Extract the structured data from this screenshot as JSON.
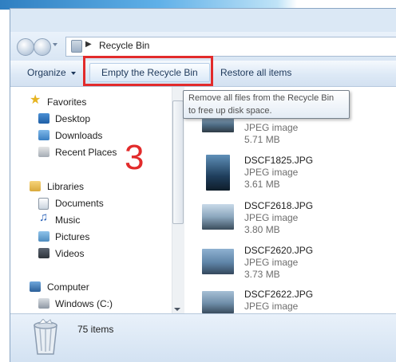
{
  "address": {
    "breadcrumb_label": "Recycle Bin"
  },
  "toolbar": {
    "organize_label": "Organize",
    "empty_bin_label": "Empty the Recycle Bin",
    "restore_label": "Restore all items"
  },
  "tooltip": {
    "line1": "Remove all files from the Recycle Bin",
    "line2": "to free up disk space."
  },
  "annotation": {
    "step_number": "3"
  },
  "nav": {
    "favorites": {
      "label": "Favorites",
      "icon": "star-icon",
      "items": [
        {
          "label": "Desktop",
          "icon": "desktop-icon"
        },
        {
          "label": "Downloads",
          "icon": "downloads-icon"
        },
        {
          "label": "Recent Places",
          "icon": "recent-places-icon"
        }
      ]
    },
    "libraries": {
      "label": "Libraries",
      "icon": "libraries-icon",
      "items": [
        {
          "label": "Documents",
          "icon": "documents-icon"
        },
        {
          "label": "Music",
          "icon": "music-icon"
        },
        {
          "label": "Pictures",
          "icon": "pictures-icon"
        },
        {
          "label": "Videos",
          "icon": "videos-icon"
        }
      ]
    },
    "computer": {
      "label": "Computer",
      "icon": "computer-icon",
      "items": [
        {
          "label": "Windows (C:)",
          "icon": "drive-icon"
        }
      ]
    }
  },
  "files": [
    {
      "name": "",
      "type": "JPEG image",
      "size": "5.71 MB"
    },
    {
      "name": "DSCF1825.JPG",
      "type": "JPEG image",
      "size": "3.61 MB"
    },
    {
      "name": "DSCF2618.JPG",
      "type": "JPEG image",
      "size": "3.80 MB"
    },
    {
      "name": "DSCF2620.JPG",
      "type": "JPEG image",
      "size": "3.73 MB"
    },
    {
      "name": "DSCF2622.JPG",
      "type": "JPEG image",
      "size": ""
    }
  ],
  "status": {
    "items_count": "75 items"
  },
  "colors": {
    "highlight": "#e22b2b",
    "toolbar_text": "#1e395b"
  }
}
